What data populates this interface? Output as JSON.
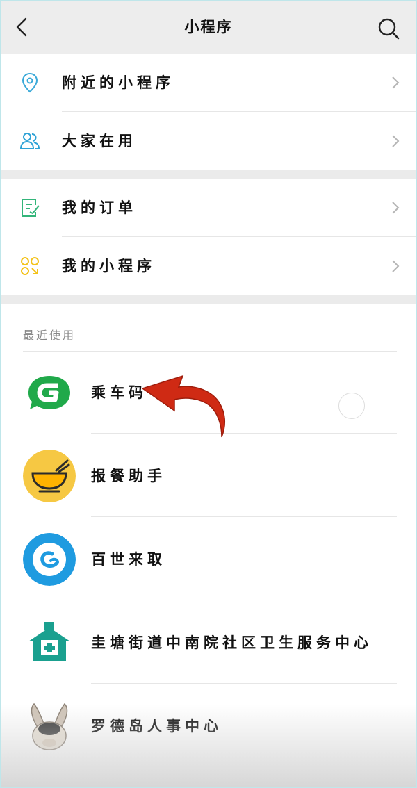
{
  "header": {
    "title": "小程序"
  },
  "menu_top": [
    {
      "label": "附近的小程序",
      "icon": "location-pin-icon"
    },
    {
      "label": "大家在用",
      "icon": "people-icon"
    }
  ],
  "menu_mid": [
    {
      "label": "我的订单",
      "icon": "order-checklist-icon"
    },
    {
      "label": "我的小程序",
      "icon": "mini-programs-icon"
    }
  ],
  "recent": {
    "label": "最近使用",
    "apps": [
      {
        "name": "乘车码",
        "icon": "bus-code-app-icon"
      },
      {
        "name": "报餐助手",
        "icon": "meal-bowl-app-icon"
      },
      {
        "name": "百世来取",
        "icon": "best-express-app-icon"
      },
      {
        "name": "圭塘街道中南院社区卫生服务中心",
        "icon": "health-center-app-icon"
      },
      {
        "name": "罗德岛人事中心",
        "icon": "rabbit-avatar-app-icon"
      }
    ]
  },
  "colors": {
    "header_bg": "#ededed",
    "location": "#3aa9d8",
    "people": "#2ea2d6",
    "order": "#33b57a",
    "mini": "#f3c21a",
    "green_app": "#20a94a",
    "yellow_app": "#f6c843",
    "blue_app": "#1f9be0",
    "teal_app": "#1aa08f",
    "arrow": "#cf2a14"
  }
}
